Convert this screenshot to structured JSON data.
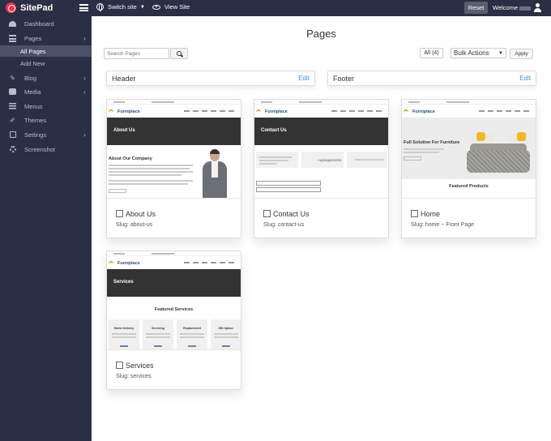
{
  "app": {
    "logo_text": "SitePad",
    "switch_site_label": "Switch site",
    "view_site_label": "View Site",
    "reset_label": "Reset",
    "welcome_label": "Welcome"
  },
  "sidebar": {
    "items": [
      {
        "label": "Dashboard",
        "icon": "dashboard-icon"
      },
      {
        "label": "Pages",
        "icon": "pages-icon",
        "has_arrow": true
      },
      {
        "label": "Blog",
        "icon": "blog-icon",
        "has_arrow": true
      },
      {
        "label": "Media",
        "icon": "media-icon",
        "has_arrow": true
      },
      {
        "label": "Menus",
        "icon": "menus-icon"
      },
      {
        "label": "Themes",
        "icon": "themes-icon"
      },
      {
        "label": "Settings",
        "icon": "settings-icon",
        "has_arrow": true
      },
      {
        "label": "Screenshot",
        "icon": "screenshot-icon"
      }
    ],
    "pages_sub": [
      {
        "label": "All Pages",
        "active": true
      },
      {
        "label": "Add New",
        "active": false
      }
    ]
  },
  "main": {
    "title": "Pages",
    "search_placeholder": "Search Pages",
    "all_count_label": "All (4)",
    "bulk_actions_label": "Bulk Actions",
    "apply_label": "Apply",
    "sections": [
      {
        "label": "Header",
        "edit_label": "Edit"
      },
      {
        "label": "Footer",
        "edit_label": "Edit"
      }
    ],
    "cards": [
      {
        "title": "About Us",
        "slug": "Slug: about-us"
      },
      {
        "title": "Contact Us",
        "slug": "Slug: contact-us"
      },
      {
        "title": "Home",
        "slug": "Slug: home ~ Front Page"
      },
      {
        "title": "Services",
        "slug": "Slug: services"
      }
    ],
    "thumbnails": {
      "brand": "Furniplace",
      "about_hero": "About Us",
      "about_heading": "About Our Company",
      "contact_hero": "Contact Us",
      "home_hero": "Full Solution For Furniture",
      "home_section": "Featured Products",
      "services_hero": "Services",
      "services_section": "Featured Services",
      "services_items": [
        "Home Delivery",
        "Servicing",
        "Replacement",
        "Gift Option"
      ],
      "contact_phone": "+1(234)5231231"
    }
  },
  "colors": {
    "topbar": "#2b2f45",
    "sidebar": "#2b2f45",
    "active_sub": "#4c5069",
    "logo_accent": "#e8354f",
    "edit_link": "#4a90d9"
  }
}
